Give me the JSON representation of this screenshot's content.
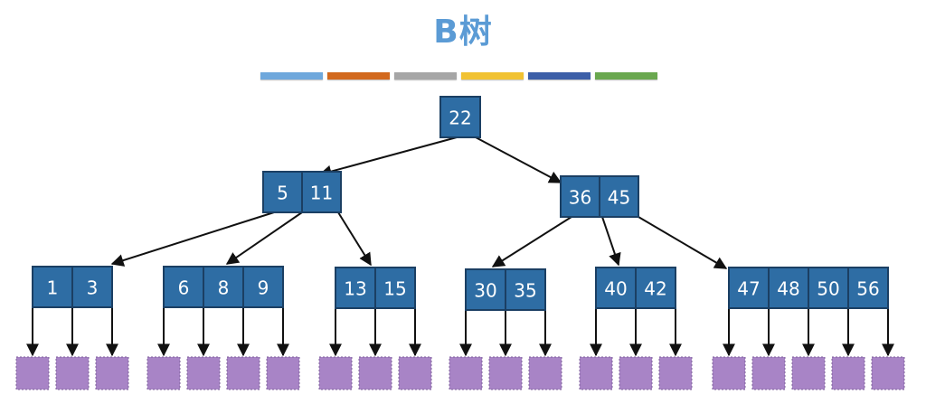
{
  "title": "B树",
  "colors": {
    "title": "#5b9bd5",
    "node_fill": "#2e6da4",
    "node_stroke": "#1b3f63",
    "leaf_fill": "#a884c6",
    "edge": "#111111",
    "bars": [
      "#6fa8dc",
      "#d2691e",
      "#a6a6a6",
      "#f1c232",
      "#3c5fa8",
      "#6aa84f"
    ]
  },
  "tree": {
    "root": {
      "keys": [
        "22"
      ]
    },
    "level1": [
      {
        "keys": [
          "5",
          "11"
        ]
      },
      {
        "keys": [
          "36",
          "45"
        ]
      }
    ],
    "level2": [
      {
        "keys": [
          "1",
          "3"
        ]
      },
      {
        "keys": [
          "6",
          "8",
          "9"
        ]
      },
      {
        "keys": [
          "13",
          "15"
        ]
      },
      {
        "keys": [
          "30",
          "35"
        ]
      },
      {
        "keys": [
          "40",
          "42"
        ]
      },
      {
        "keys": [
          "47",
          "48",
          "50",
          "56"
        ]
      }
    ]
  }
}
